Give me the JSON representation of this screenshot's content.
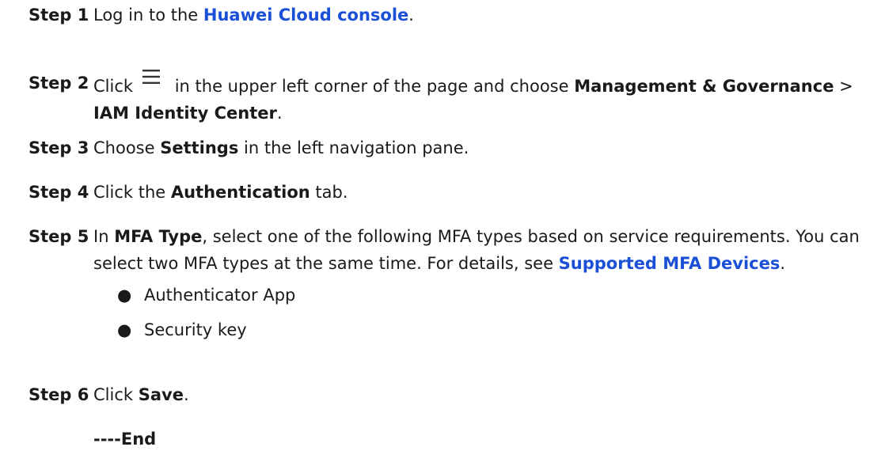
{
  "steps": [
    {
      "label": "Step 1",
      "text_before": "Log in to the ",
      "link": "Huawei Cloud console",
      "text_after": "."
    },
    {
      "label": "Step 2",
      "text_before": "Click",
      "icon": "hamburger-menu-icon",
      "text_mid": " in the upper left corner of the page and choose ",
      "bold1": "Management & Governance",
      "sep": " > ",
      "bold2": "IAM Identity Center",
      "text_after": "."
    },
    {
      "label": "Step 3",
      "text_before": "Choose ",
      "bold": "Settings",
      "text_after": " in the left navigation pane."
    },
    {
      "label": "Step 4",
      "text_before": "Click the ",
      "bold": "Authentication",
      "text_after": " tab."
    },
    {
      "label": "Step 5",
      "text_before": "In ",
      "bold": "MFA Type",
      "text_mid": ", select one of the following MFA types based on service requirements. You can select two MFA types at the same time. For details, see ",
      "link": "Supported MFA Devices",
      "text_after": ".",
      "bullets": [
        "Authenticator App",
        "Security key"
      ],
      "bullet_char": "●"
    },
    {
      "label": "Step 6",
      "text_before": "Click ",
      "bold": "Save",
      "text_after": "."
    }
  ],
  "end_mark": "----End",
  "colors": {
    "link": "#1a4fd6",
    "text": "#1a1a1a"
  }
}
